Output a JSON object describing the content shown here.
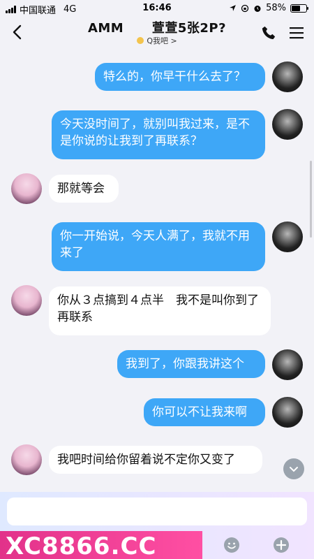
{
  "status": {
    "carrier": "中国联通",
    "network": "4G",
    "time": "16:46",
    "battery": "58%",
    "battery_level": 0.58
  },
  "header": {
    "title": "AMM      萱萱5张2P?",
    "subtitle": "Q我吧 >"
  },
  "messages": [
    {
      "from": "me",
      "text": "特么的，你早干什么去了？"
    },
    {
      "from": "me",
      "text": "今天没时间了，就别叫我过来，是不是你说的让我到了再联系？"
    },
    {
      "from": "them",
      "text": "那就等会"
    },
    {
      "from": "me",
      "text": "你一开始说，今天人满了，我就不用来了"
    },
    {
      "from": "them",
      "text": "你从３点搞到４点半　我不是叫你到了再联系"
    },
    {
      "from": "me",
      "text": "我到了，你跟我讲这个"
    },
    {
      "from": "me",
      "text": "你可以不让我来啊"
    },
    {
      "from": "them",
      "text": "我吧时间给你留着说不定你又变了"
    }
  ],
  "input": {
    "placeholder": "",
    "value": ""
  },
  "watermark": "XC8866.CC",
  "colors": {
    "my_bubble": "#3ea7f7",
    "their_bubble": "#ffffff",
    "background": "#f2f2f7",
    "watermark": "#e2328a"
  },
  "icons": {
    "back": "chevron-left-icon",
    "phone": "phone-icon",
    "menu": "menu-icon",
    "scroll_down": "chevron-down-icon",
    "emoji": "smiley-icon",
    "plus": "plus-icon"
  }
}
